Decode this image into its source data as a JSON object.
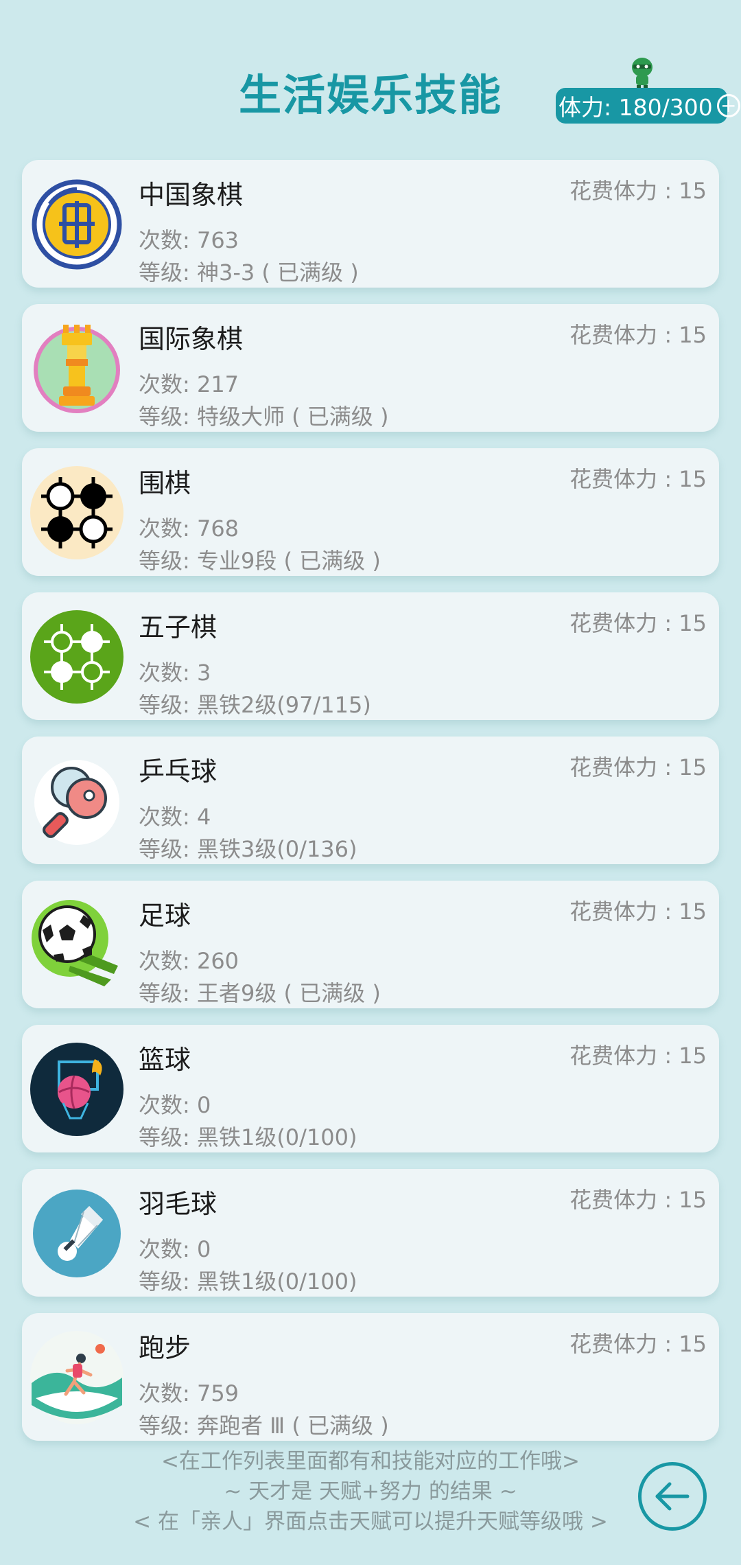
{
  "header": {
    "title": "生活娱乐技能",
    "stamina_label": "体力: 180/300",
    "stamina_plus": "+"
  },
  "colors": {
    "accent": "#1897a4",
    "background": "#cde9ec",
    "card": "#eef5f7",
    "muted_text": "#8c8c8c"
  },
  "skills": [
    {
      "name": "中国象棋",
      "cost": "花费体力 : 15",
      "count": "次数: 763",
      "level": "等级: 神3-3 ( 已满级 )",
      "icon": "chinese-chess-icon"
    },
    {
      "name": "国际象棋",
      "cost": "花费体力 : 15",
      "count": "次数: 217",
      "level": "等级: 特级大师 ( 已满级 )",
      "icon": "chess-rook-icon"
    },
    {
      "name": "围棋",
      "cost": "花费体力 : 15",
      "count": "次数: 768",
      "level": "等级: 专业9段 ( 已满级 )",
      "icon": "go-stones-icon"
    },
    {
      "name": "五子棋",
      "cost": "花费体力 : 15",
      "count": "次数: 3",
      "level": "等级: 黑铁2级(97/115)",
      "icon": "gomoku-icon"
    },
    {
      "name": "乒乓球",
      "cost": "花费体力 : 15",
      "count": "次数: 4",
      "level": "等级: 黑铁3级(0/136)",
      "icon": "ping-pong-icon"
    },
    {
      "name": "足球",
      "cost": "花费体力 : 15",
      "count": "次数: 260",
      "level": "等级: 王者9级 ( 已满级 )",
      "icon": "soccer-ball-icon"
    },
    {
      "name": "篮球",
      "cost": "花费体力 : 15",
      "count": "次数: 0",
      "level": "等级: 黑铁1级(0/100)",
      "icon": "basketball-icon"
    },
    {
      "name": "羽毛球",
      "cost": "花费体力 : 15",
      "count": "次数: 0",
      "level": "等级: 黑铁1级(0/100)",
      "icon": "shuttlecock-icon"
    },
    {
      "name": "跑步",
      "cost": "花费体力 : 15",
      "count": "次数: 759",
      "level": "等级: 奔跑者 Ⅲ ( 已满级 )",
      "icon": "running-icon"
    }
  ],
  "footer": {
    "line1": "<在工作列表里面都有和技能对应的工作哦>",
    "line2": "~ 天才是 天赋+努力 的结果 ~",
    "line3": "< 在「亲人」界面点击天赋可以提升天赋等级哦 >"
  }
}
